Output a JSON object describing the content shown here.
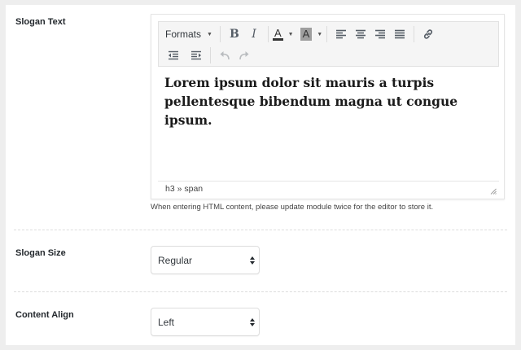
{
  "slogan_text": {
    "label": "Slogan Text",
    "toolbar": {
      "formats_label": "Formats",
      "bold_glyph": "B",
      "italic_glyph": "I",
      "text_color_glyph": "A",
      "background_color_glyph": "A"
    },
    "content": "Lorem ipsum dolor sit mauris a turpis pellentesque bibendum magna ut congue ipsum.",
    "status_path": "h3 » span",
    "help_text": "When entering HTML content, please update module twice for the editor to store it."
  },
  "slogan_size": {
    "label": "Slogan Size",
    "selected": "Regular"
  },
  "content_align": {
    "label": "Content Align",
    "selected": "Left"
  },
  "icons": [
    "bold-icon",
    "italic-icon",
    "text-color-icon",
    "background-color-icon",
    "align-left-icon",
    "align-center-icon",
    "align-right-icon",
    "justify-icon",
    "link-icon",
    "outdent-icon",
    "indent-icon",
    "undo-icon",
    "redo-icon"
  ],
  "colors": {
    "page_bg": "#eeeeee",
    "panel_bg": "#ffffff",
    "toolbar_bg": "#f5f5f5",
    "icon": "#555d66"
  }
}
